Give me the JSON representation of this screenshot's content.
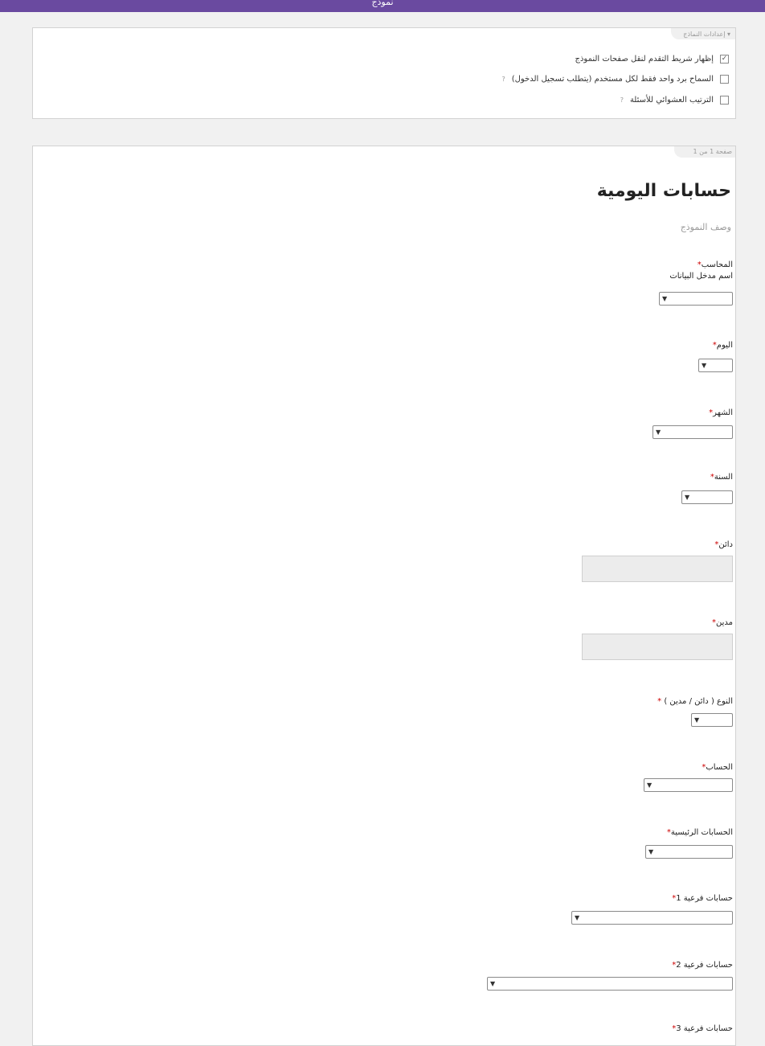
{
  "header": {
    "title": "نموذج"
  },
  "settings": {
    "section_label": "إعدادات النماذج",
    "options": [
      {
        "label": "إظهار شريط التقدم لنقل صفحات النموذج",
        "checked": true,
        "help": ""
      },
      {
        "label": "السماح برد واحد فقط لكل مستخدم (يتطلب تسجيل الدخول)",
        "checked": false,
        "help": "?"
      },
      {
        "label": "الترتيب العشوائي للأسئلة",
        "checked": false,
        "help": "?"
      }
    ]
  },
  "form": {
    "page_indicator": "صفحة 1 من 1",
    "title": "حسابات اليومية",
    "description": "وصف النموذج",
    "fields": [
      {
        "label": "المحاسب",
        "required": "*",
        "help": "اسم مدخل البيانات",
        "type": "select"
      },
      {
        "label": "اليوم",
        "required": "*",
        "help": "",
        "type": "select"
      },
      {
        "label": "الشهر",
        "required": "*",
        "help": "",
        "type": "select"
      },
      {
        "label": "السنة",
        "required": "*",
        "help": "",
        "type": "select"
      },
      {
        "label": "دائن",
        "required": "*",
        "help": "",
        "type": "text"
      },
      {
        "label": "مدين",
        "required": "*",
        "help": "",
        "type": "text"
      },
      {
        "label": "النوع ( دائن / مدين )",
        "required": " *",
        "help": "",
        "type": "select"
      },
      {
        "label": "الحساب",
        "required": "*",
        "help": "",
        "type": "select"
      },
      {
        "label": "الحسابات الرئيسية",
        "required": "*",
        "help": "",
        "type": "select"
      },
      {
        "label": "حسابات فرعية 1",
        "required": "*",
        "help": "",
        "type": "select"
      },
      {
        "label": "حسابات فرعية 2",
        "required": "*",
        "help": "",
        "type": "select"
      },
      {
        "label": "حسابات فرعية 3",
        "required": "*",
        "help": "",
        "type": "select"
      }
    ],
    "dropdown_arrow": "▼"
  }
}
